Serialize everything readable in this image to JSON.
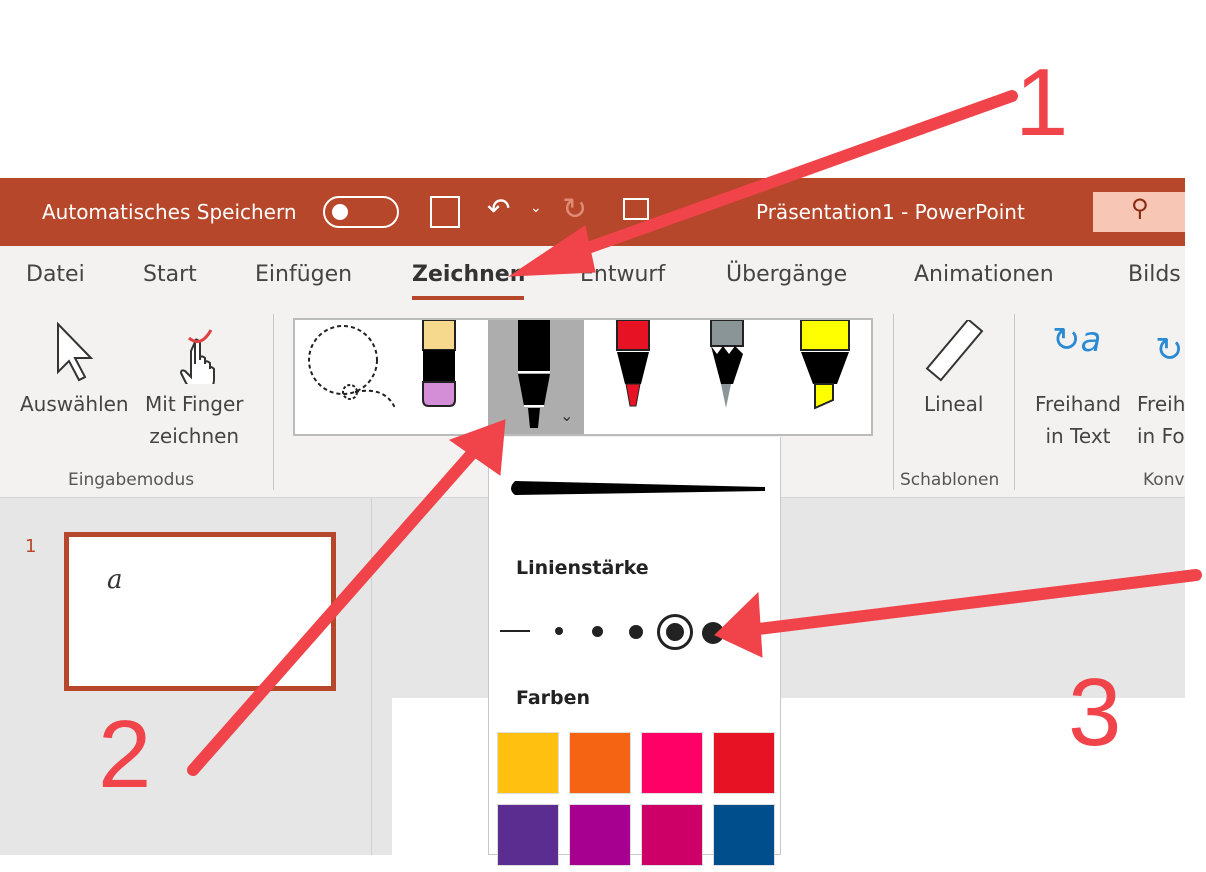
{
  "titlebar": {
    "autosave_label": "Automatisches Speichern",
    "title": "Präsentation1  -  PowerPoint",
    "color": "#B7472A"
  },
  "tabs": [
    {
      "label": "Datei"
    },
    {
      "label": "Start"
    },
    {
      "label": "Einfügen"
    },
    {
      "label": "Zeichnen",
      "active": true
    },
    {
      "label": "Entwurf"
    },
    {
      "label": "Übergänge"
    },
    {
      "label": "Animationen"
    },
    {
      "label": "Bilds"
    }
  ],
  "ribbon": {
    "select_label": "Auswählen",
    "finger_label1": "Mit Finger",
    "finger_label2": "zeichnen",
    "group_input": "Eingabemodus",
    "ruler_label": "Lineal",
    "group_templates": "Schablonen",
    "ink_text1": "Freihand",
    "ink_text2": "in Text",
    "ink_shape1": "Freih",
    "ink_shape2": "in Fo",
    "group_convert": "Konv",
    "pens": [
      "lasso",
      "eraser",
      "black-pen (selected)",
      "red-pen",
      "pencil",
      "yellow-highlighter"
    ]
  },
  "slides": {
    "number": "1",
    "thumb_text": "a"
  },
  "popup": {
    "thickness_label": "Linienstärke",
    "colors_label": "Farben",
    "selected_thickness_index": 4,
    "colors": [
      "#FFC010",
      "#F56413",
      "#FF0066",
      "#E71224",
      "#5B2D90",
      "#A70090",
      "#CC0066",
      "#004E8C"
    ]
  },
  "annotations": {
    "n1": "1",
    "n2": "2",
    "n3": "3",
    "arrow_color": "#F0434A"
  }
}
